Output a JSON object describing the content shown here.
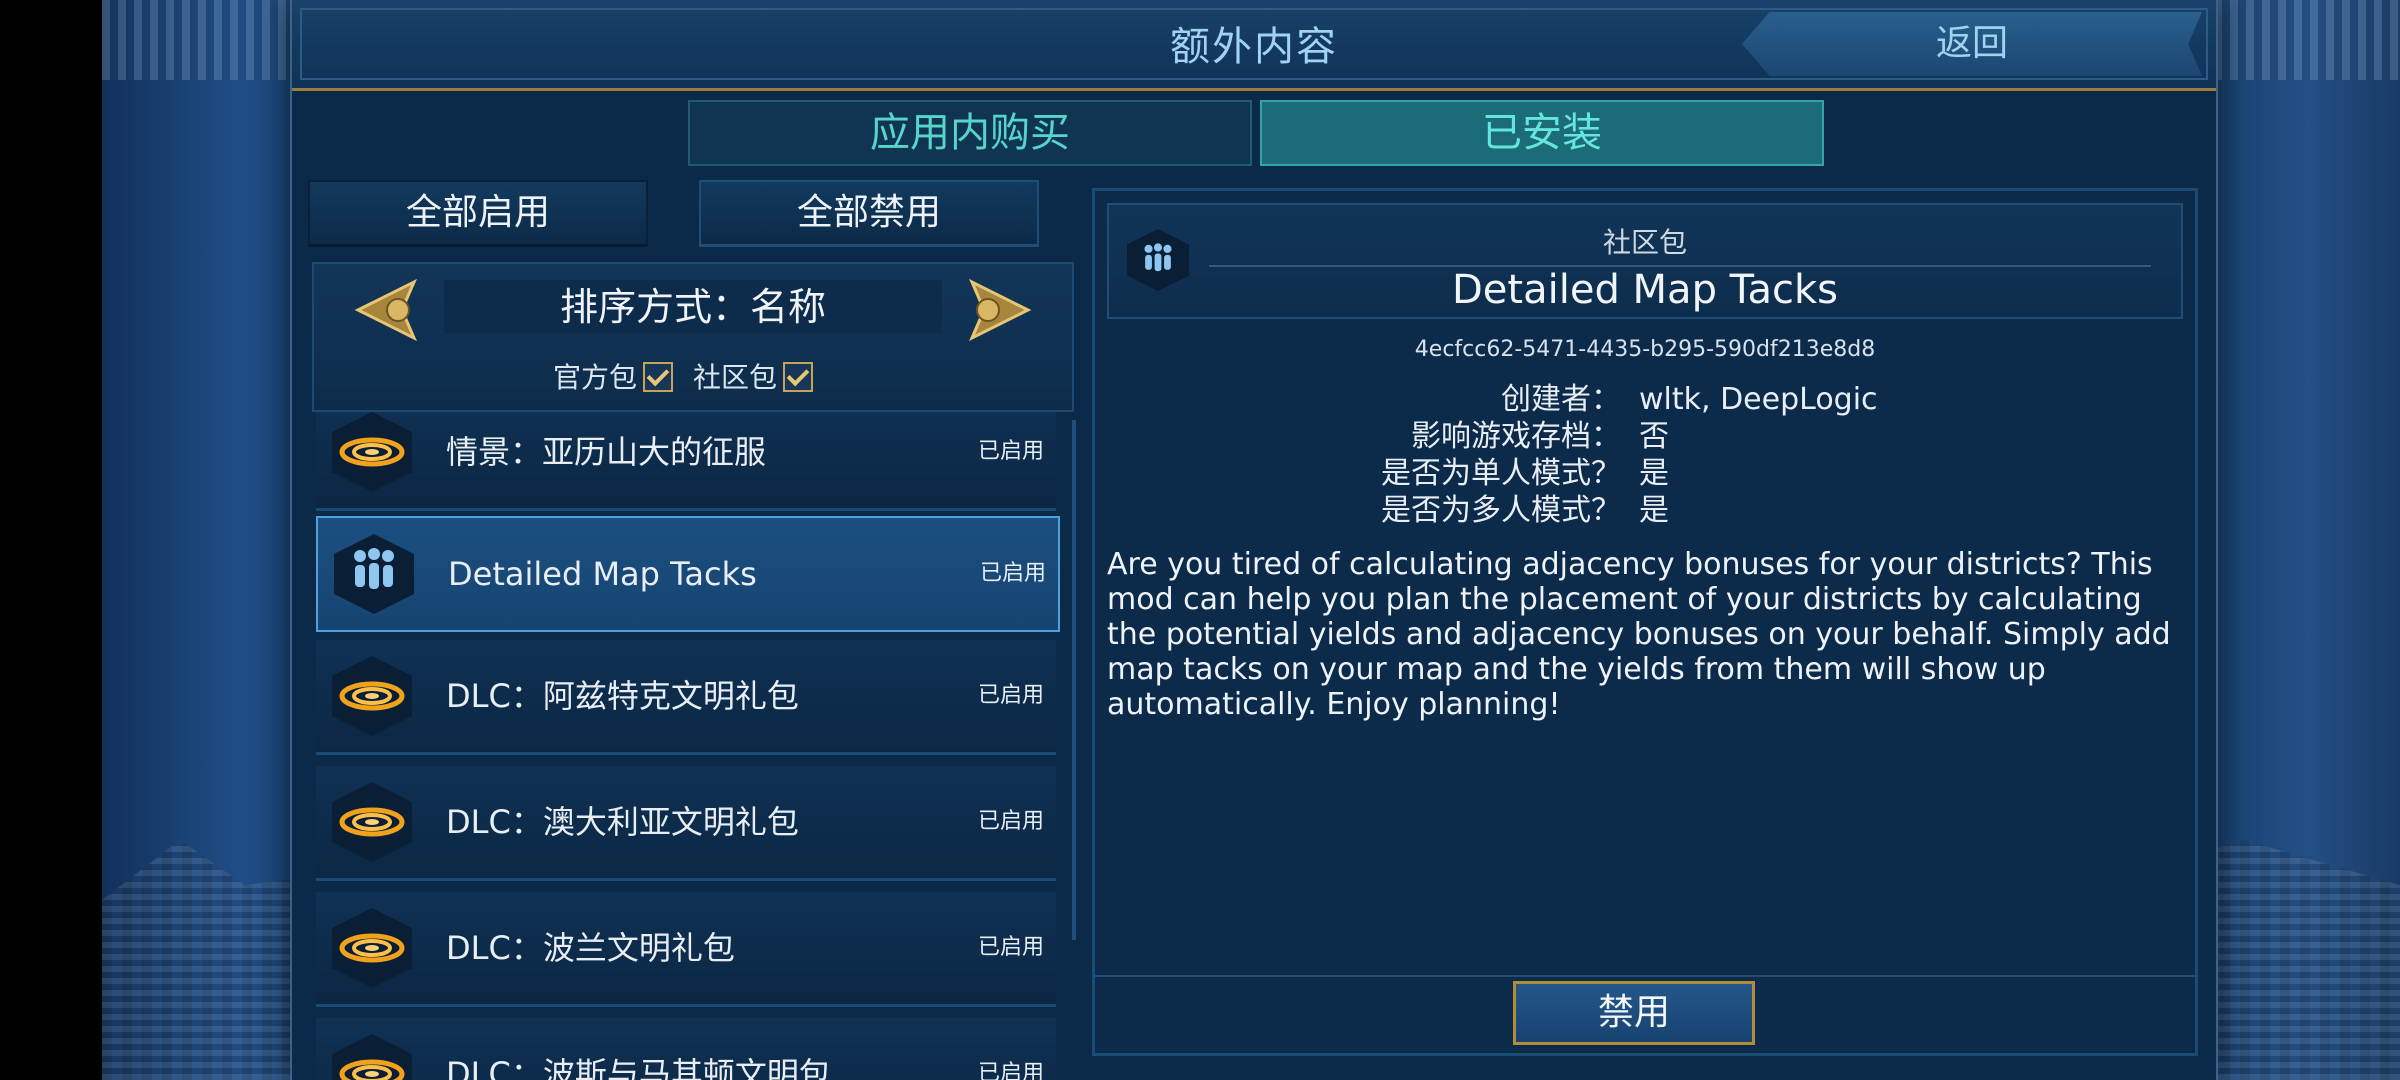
{
  "header": {
    "title": "额外内容",
    "back_label": "返回"
  },
  "tabs": [
    {
      "label": "应用内购买",
      "active": false
    },
    {
      "label": "已安装",
      "active": true
    }
  ],
  "controls": {
    "enable_all": "全部启用",
    "disable_all": "全部禁用"
  },
  "sort": {
    "label": "排序方式：名称"
  },
  "filters": [
    {
      "label": "官方包",
      "checked": true
    },
    {
      "label": "社区包",
      "checked": true
    }
  ],
  "list": [
    {
      "label": "情景：亚历山大的征服",
      "status": "已启用",
      "icon": "swirl-icon",
      "selected": false
    },
    {
      "label": "Detailed Map Tacks",
      "status": "已启用",
      "icon": "community-icon",
      "selected": true
    },
    {
      "label": "DLC：阿兹特克文明礼包",
      "status": "已启用",
      "icon": "swirl-icon",
      "selected": false
    },
    {
      "label": "DLC：澳大利亚文明礼包",
      "status": "已启用",
      "icon": "swirl-icon",
      "selected": false
    },
    {
      "label": "DLC：波兰文明礼包",
      "status": "已启用",
      "icon": "swirl-icon",
      "selected": false
    },
    {
      "label": "DLC：波斯与马其顿文明包",
      "status": "已启用",
      "icon": "swirl-icon",
      "selected": false
    }
  ],
  "details": {
    "category": "社区包",
    "title": "Detailed Map Tacks",
    "id": "4ecfcc62-5471-4435-b295-590df213e8d8",
    "fields": [
      {
        "key": "创建者：",
        "value": "wltk, DeepLogic"
      },
      {
        "key": "影响游戏存档：",
        "value": "否"
      },
      {
        "key": "是否为单人模式？",
        "value": "是"
      },
      {
        "key": "是否为多人模式？",
        "value": "是"
      }
    ],
    "description": "Are you tired of calculating adjacency bonuses for your districts? This mod can help you plan the placement of your districts by calculating the potential yields and adjacency bonuses on your behalf. Simply add map tacks on your map and the yields from them will show up automatically. Enjoy planning!",
    "action_label": "禁用"
  },
  "colors": {
    "accent_gold": "#b48b3b",
    "teal_active": "#64e6dc",
    "panel": "#0c2a4a"
  }
}
